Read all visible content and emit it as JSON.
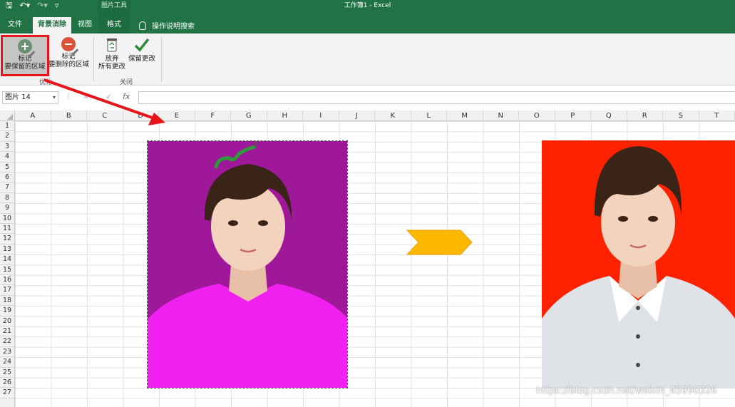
{
  "titlebar": {
    "context_tools": "图片工具",
    "title": "工作簿1 - Excel"
  },
  "tabs": {
    "file": "文件",
    "bg_removal": "背景消除",
    "view": "视图",
    "format": "格式",
    "tell_me": "操作说明搜索"
  },
  "ribbon": {
    "mark_keep_line1": "标记",
    "mark_keep_line2": "要保留的区域",
    "mark_remove_line1": "标记",
    "mark_remove_line2": "要删除的区域",
    "discard_line1": "放弃",
    "discard_line2": "所有更改",
    "keep_changes": "保留更改",
    "group_refine": "优化",
    "group_close": "关闭"
  },
  "formula_bar": {
    "name_box": "图片 14",
    "fx": "fx"
  },
  "columns": [
    "A",
    "B",
    "C",
    "D",
    "E",
    "F",
    "G",
    "H",
    "I",
    "J",
    "K",
    "L",
    "M",
    "N",
    "O",
    "P",
    "Q",
    "R",
    "S",
    "T"
  ],
  "rows": [
    "1",
    "2",
    "3",
    "4",
    "5",
    "6",
    "7",
    "8",
    "9",
    "10",
    "11",
    "12",
    "13",
    "14",
    "15",
    "16",
    "17",
    "18",
    "19",
    "20",
    "21",
    "22",
    "23",
    "24",
    "25",
    "26",
    "27"
  ],
  "colors": {
    "excel_green": "#217346",
    "left_bg_marked": "#a0189a",
    "shirt_marked": "#f020f0",
    "right_bg": "#ff2200",
    "chevron": "#ffb800",
    "highlight": "#e8141c"
  },
  "watermark": "https://blog.csdn.net/weixin_45990326"
}
